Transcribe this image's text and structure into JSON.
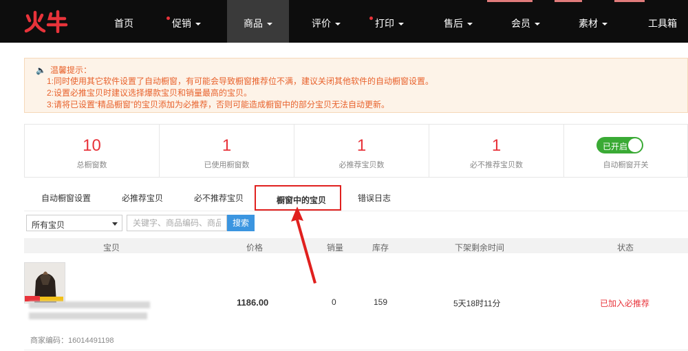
{
  "nav": {
    "logo_text": "火牛",
    "items": [
      {
        "label": "首页",
        "caret": false,
        "dot": false
      },
      {
        "label": "促销",
        "caret": true,
        "dot": true
      },
      {
        "label": "商品",
        "caret": true,
        "dot": false,
        "active": true
      },
      {
        "label": "评价",
        "caret": true,
        "dot": false
      },
      {
        "label": "打印",
        "caret": true,
        "dot": true
      },
      {
        "label": "售后",
        "caret": true,
        "dot": false
      },
      {
        "label": "会员",
        "caret": true,
        "dot": false
      },
      {
        "label": "素材",
        "caret": true,
        "dot": false
      },
      {
        "label": "工具箱",
        "caret": false,
        "dot": false
      }
    ]
  },
  "tip": {
    "title": "温馨提示：",
    "lines": [
      "1:同时使用其它软件设置了自动橱窗，有可能会导致橱窗推荐位不满，建议关闭其他软件的自动橱窗设置。",
      "2:设置必推宝贝时建议选择爆款宝贝和销量最高的宝贝。",
      "3:请将已设置“精品橱窗”的宝贝添加为必推荐，否则可能造成橱窗中的部分宝贝无法自动更新。"
    ]
  },
  "stats": [
    {
      "value": "10",
      "label": "总橱窗数"
    },
    {
      "value": "1",
      "label": "已使用橱窗数"
    },
    {
      "value": "1",
      "label": "必推荐宝贝数"
    },
    {
      "value": "1",
      "label": "必不推荐宝贝数"
    }
  ],
  "auto_switch": {
    "state_label": "已开启",
    "label": "自动橱窗开关",
    "on": true
  },
  "tabs": [
    "自动橱窗设置",
    "必推荐宝贝",
    "必不推荐宝贝",
    "橱窗中的宝贝",
    "错误日志"
  ],
  "filter": {
    "select_value": "所有宝贝",
    "search_placeholder": "关键字、商品编码、商品ID",
    "search_label": "搜索"
  },
  "table": {
    "headers": [
      "宝贝",
      "价格",
      "销量",
      "库存",
      "下架剩余时间",
      "状态"
    ],
    "rows": [
      {
        "price": "1186.00",
        "sales": "0",
        "stock": "159",
        "remaining": "5天18时11分",
        "status": "已加入必推荐",
        "sku": "商家编码：16014491198"
      }
    ]
  },
  "colors": {
    "accent": "#e8333a",
    "nav_bg": "#0d0d0d",
    "tip_text": "#e8622c",
    "toggle_on": "#3aaa35",
    "search_btn": "#3b95e0"
  }
}
